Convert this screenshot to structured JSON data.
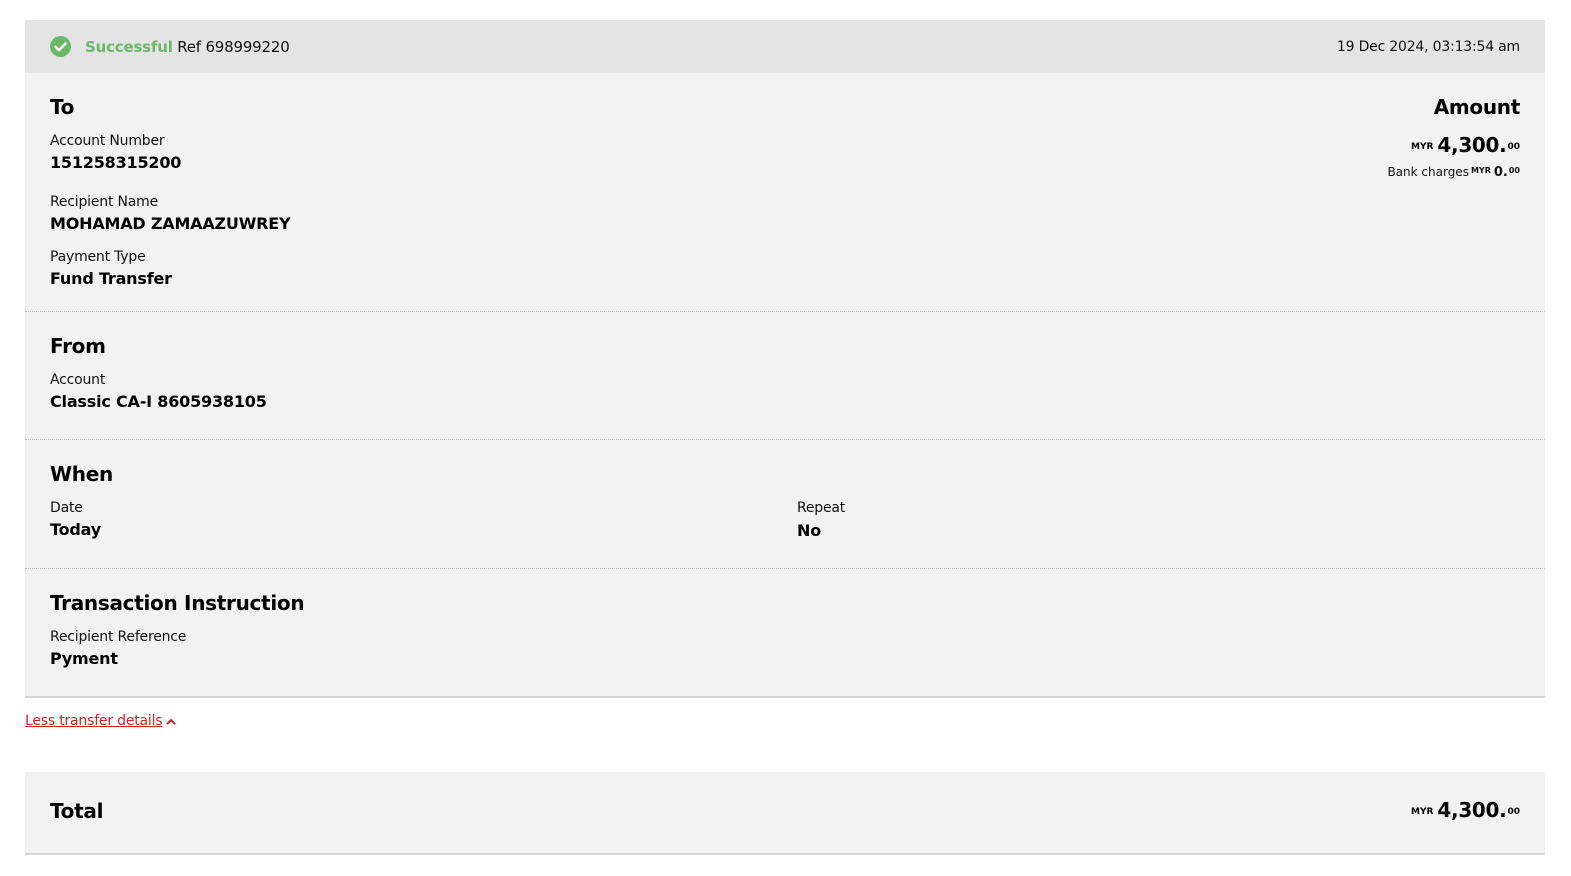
{
  "status": {
    "label": "Successful",
    "ref": "Ref 698999220",
    "datetime": "19 Dec 2024, 03:13:54 am",
    "color": "#6cb86a"
  },
  "to": {
    "heading": "To",
    "account_number_label": "Account Number",
    "account_number": "151258315200",
    "recipient_name_label": "Recipient Name",
    "recipient_name": "MOHAMAD ZAMAAZUWREY",
    "payment_type_label": "Payment Type",
    "payment_type": "Fund Transfer"
  },
  "amount": {
    "heading": "Amount",
    "currency": "MYR",
    "whole": "4,300.",
    "cents": "00",
    "bank_charges_label": "Bank charges",
    "bank_charges_currency": "MYR",
    "bank_charges_whole": "0.",
    "bank_charges_cents": "00"
  },
  "from": {
    "heading": "From",
    "account_label": "Account",
    "account": "Classic CA-I 8605938105"
  },
  "when": {
    "heading": "When",
    "date_label": "Date",
    "date": "Today",
    "repeat_label": "Repeat",
    "repeat": "No"
  },
  "instruction": {
    "heading": "Transaction Instruction",
    "recipient_reference_label": "Recipient Reference",
    "recipient_reference": "Pyment"
  },
  "toggle": {
    "label": "Less transfer details",
    "icon": "chevron-up-icon",
    "color": "#d71e28"
  },
  "total": {
    "label": "Total",
    "currency": "MYR",
    "whole": "4,300.",
    "cents": "00"
  }
}
